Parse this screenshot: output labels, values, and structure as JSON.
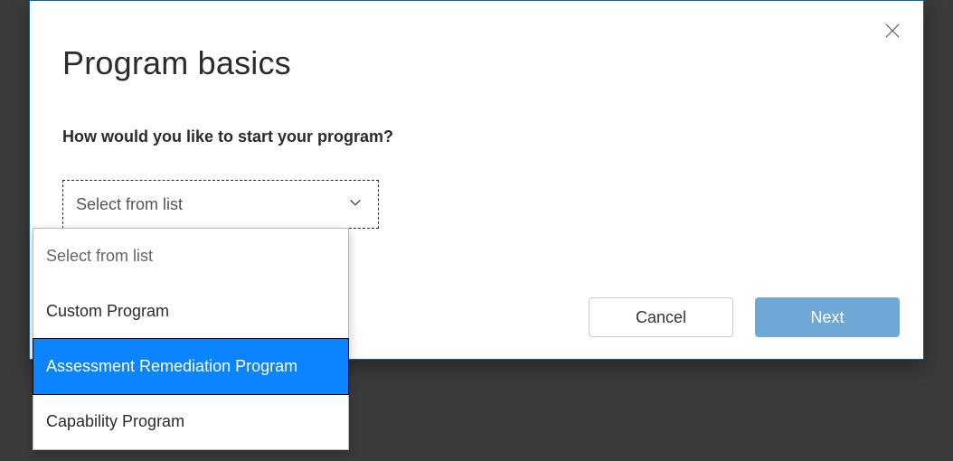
{
  "modal": {
    "title": "Program basics",
    "question": "How would you like to start your program?",
    "select": {
      "current": "Select from list",
      "options": [
        {
          "label": "Select from list",
          "is_placeholder": true,
          "highlighted": false
        },
        {
          "label": "Custom Program",
          "is_placeholder": false,
          "highlighted": false
        },
        {
          "label": "Assessment Remediation Program",
          "is_placeholder": false,
          "highlighted": true
        },
        {
          "label": "Capability Program",
          "is_placeholder": false,
          "highlighted": false
        }
      ]
    },
    "buttons": {
      "cancel": "Cancel",
      "next": "Next"
    }
  }
}
